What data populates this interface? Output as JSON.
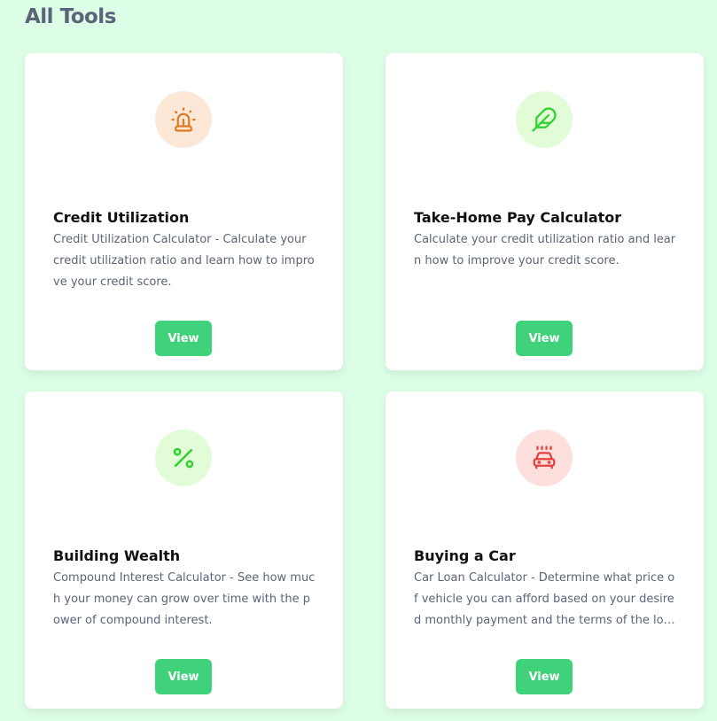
{
  "page": {
    "title": "All Tools"
  },
  "tools": [
    {
      "title": "Credit Utilization",
      "description": "Credit Utilization Calculator - Calculate your credit utilization ratio and learn how to improve your credit score.",
      "button_label": "View",
      "icon": "siren-icon",
      "icon_color": "#e07b24",
      "icon_bg": "#fde7d6"
    },
    {
      "title": "Take-Home Pay Calculator",
      "description": "Calculate your credit utilization ratio and learn how to improve your credit score.",
      "button_label": "View",
      "icon": "feather-icon",
      "icon_color": "#2fd12f",
      "icon_bg": "#e3fcd8"
    },
    {
      "title": "Building Wealth",
      "description": "Compound Interest Calculator - See how much your money can grow over time with the power of compound interest.",
      "button_label": "View",
      "icon": "percent-icon",
      "icon_color": "#2fd12f",
      "icon_bg": "#e3fcd8"
    },
    {
      "title": "Buying a Car",
      "description": "Car Loan Calculator - Determine what price of vehicle you can afford based on your desired monthly payment and the terms of the loan.",
      "button_label": "View",
      "icon": "car-icon",
      "icon_color": "#e53e3e",
      "icon_bg": "#fde0de"
    }
  ]
}
